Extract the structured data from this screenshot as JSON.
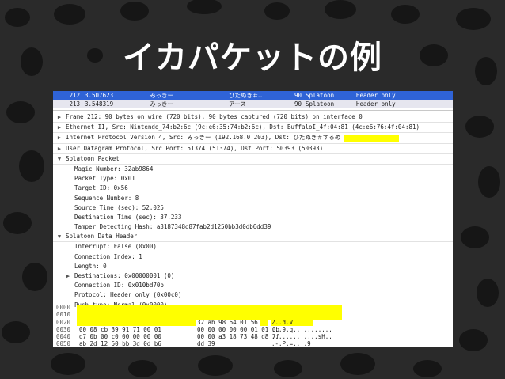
{
  "title": "イカパケットの例",
  "colors": {
    "background": "#2a2a2a",
    "selected_row": "#2f63d6",
    "highlight": "#ffff00"
  },
  "packet_list": [
    {
      "no": "212",
      "time": "3.507623",
      "src": "みっきー",
      "dst": "ひたぬき＃…",
      "len": "90",
      "proto": "Splatoon",
      "info": "Header only",
      "selected": true
    },
    {
      "no": "213",
      "time": "3.548319",
      "src": "みっきー",
      "dst": "アース",
      "len": "90",
      "proto": "Splatoon",
      "info": "Header only",
      "selected": false
    }
  ],
  "tree": [
    {
      "text": "Frame 212: 90 bytes on wire (720 bits), 90 bytes captured (720 bits) on interface 0",
      "level": 0,
      "arrow": "▶"
    },
    {
      "text": "Ethernet II, Src: Nintendo_74:b2:6c (9c:e6:35:74:b2:6c), Dst: BuffaloI_4f:04:81 (4c:e6:76:4f:04:81)",
      "level": 0,
      "arrow": "▶"
    },
    {
      "text": "Internet Protocol Version 4, Src: みっきー (192.168.0.203), Dst: ひたぬき＃するめ",
      "level": 0,
      "arrow": "▶",
      "highlight": true
    },
    {
      "text": "User Datagram Protocol, Src Port: 51374 (51374), Dst Port: 50393 (50393)",
      "level": 0,
      "arrow": "▶"
    },
    {
      "text": "Splatoon Packet",
      "level": 0,
      "arrow": "▼"
    },
    {
      "text": "Magic Number: 32ab9864",
      "level": 1
    },
    {
      "text": "Packet Type: 0x01",
      "level": 1
    },
    {
      "text": "Target ID: 0x56",
      "level": 1
    },
    {
      "text": "Sequence Number: 8",
      "level": 1
    },
    {
      "text": "Source Time (sec): 52.025",
      "level": 1
    },
    {
      "text": "Destination Time (sec): 37.233",
      "level": 1
    },
    {
      "text": "Tamper Detecting Hash: a3187348d87fab2d1250bb3d0db6dd39",
      "level": 1
    },
    {
      "text": "Splatoon Data Header",
      "level": 0,
      "arrow": "▼"
    },
    {
      "text": "Interrupt: False (0x00)",
      "level": 1
    },
    {
      "text": "Connection Index: 1",
      "level": 1
    },
    {
      "text": "Length: 0",
      "level": 1
    },
    {
      "text": "Destinations: 0x00000001 (0)",
      "level": 1,
      "arrow": "▶"
    },
    {
      "text": "Connection ID: 0x010bd70b",
      "level": 1
    },
    {
      "text": "Protocol: Header only (0x00c0)",
      "level": 1
    },
    {
      "text": "Push type: Normal (0x0000)",
      "level": 1
    }
  ],
  "hex": [
    {
      "off": "0000",
      "b1": "",
      "b2": "",
      "asc": ""
    },
    {
      "off": "0010",
      "b1": "",
      "b2": "",
      "asc": ""
    },
    {
      "off": "0020",
      "b1": "",
      "b2": "32 ab 98 64 01 56",
      "asc": "2..d.V"
    },
    {
      "off": "0030",
      "b1": "00 08 cb 39 91 71 00 01",
      "b2": "00 00 00 00 00 01 01 0b",
      "asc": "...9.q.. ........"
    },
    {
      "off": "0040",
      "b1": "d7 0b 00 c0 00 00 00 00",
      "b2": "00 00 a3 18 73 48 d8 7f",
      "asc": "........ ....sH.."
    },
    {
      "off": "0050",
      "b1": "ab 2d 12 50 bb 3d 0d b6",
      "b2": "dd 39",
      "asc": ".-.P.=.. .9"
    }
  ]
}
